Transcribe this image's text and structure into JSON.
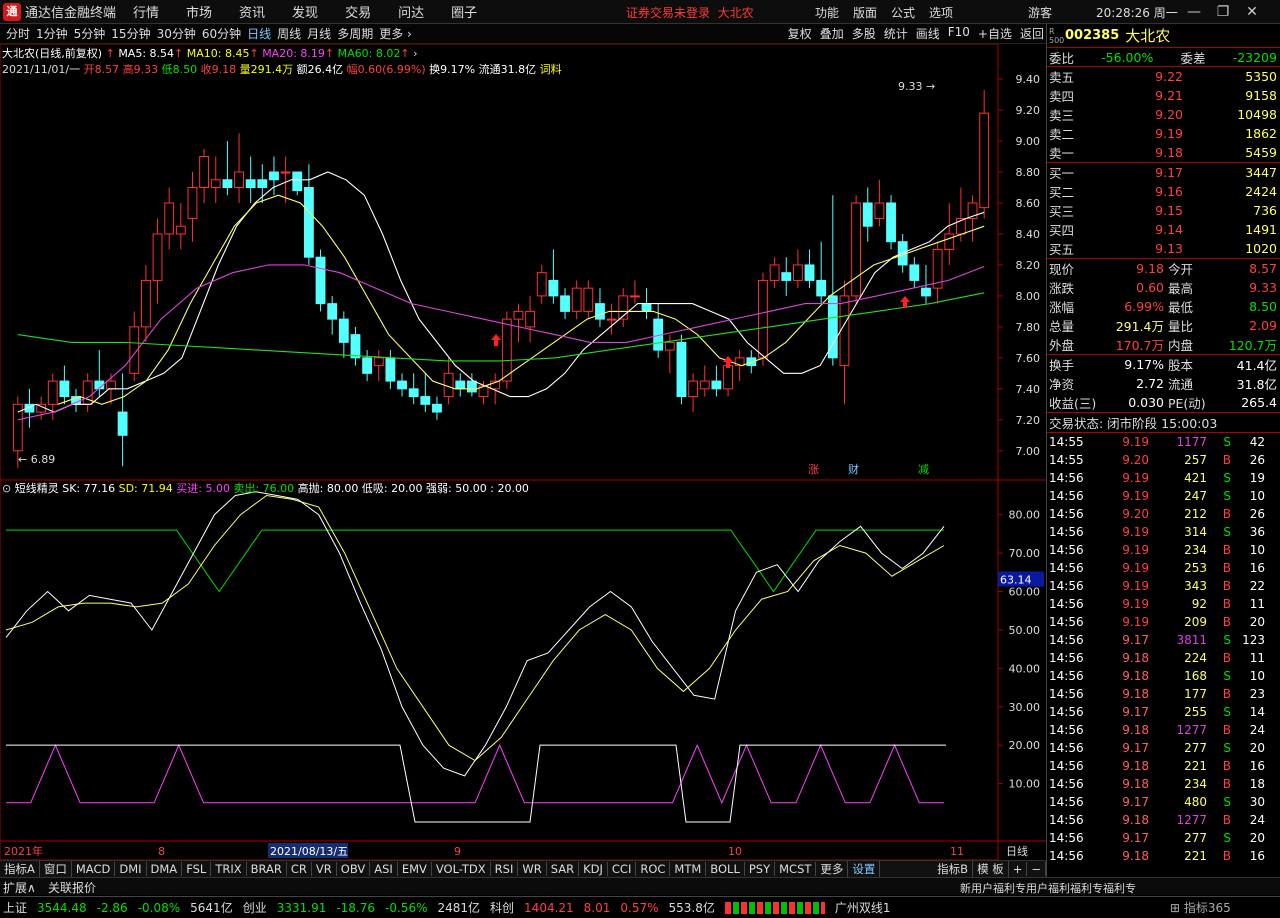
{
  "titlebar": {
    "logo": "通",
    "app": "通达信金融终端",
    "menus": [
      "行情",
      "市场",
      "资讯",
      "发现",
      "交易",
      "问达",
      "圈子"
    ],
    "warn": "证券交易未登录",
    "warn_stock": "大北农",
    "right_items": [
      "功能",
      "版面",
      "公式",
      "选项"
    ],
    "guest": "游客",
    "time": "20:28:26 周一"
  },
  "toolbar": {
    "periods": [
      "分时",
      "1分钟",
      "5分钟",
      "15分钟",
      "30分钟",
      "60分钟",
      "日线",
      "周线",
      "月线",
      "多周期",
      "更多 ›"
    ],
    "active": "日线",
    "right": [
      "复权",
      "叠加",
      "多股",
      "统计",
      "画线",
      "F10",
      "+自选",
      "返回"
    ]
  },
  "info": {
    "name": "大北农(日线,前复权)",
    "ma5": "MA5: 8.54",
    "ma10": "MA10: 8.45",
    "ma20": "MA20: 8.19",
    "ma60": "MA60: 8.02",
    "date": "2021/11/01/一",
    "open": "开8.57",
    "high": "高9.33",
    "low": "低8.50",
    "close": "收9.18",
    "vol": "量291.4万",
    "amt": "额26.4亿",
    "chg": "幅0.60(6.99%)",
    "turn": "换9.17%",
    "float": "流通31.8亿",
    "extra": "词料"
  },
  "chart_data": [
    {
      "type": "candlestick",
      "title": "大北农(日线,前复权)",
      "ylim": [
        6.89,
        9.33
      ],
      "yticks": [
        7.0,
        7.2,
        7.4,
        7.6,
        7.8,
        8.0,
        8.2,
        8.4,
        8.6,
        8.8,
        9.0,
        9.2,
        9.4
      ],
      "xlabels": [
        "2021年",
        "8",
        "2021/08/13/五",
        "9",
        "10",
        "11"
      ],
      "annotations": [
        "9.33",
        "6.89",
        "涨",
        "财",
        "减"
      ],
      "ohlc": [
        [
          7.0,
          7.35,
          6.89,
          7.3
        ],
        [
          7.3,
          7.4,
          7.15,
          7.25
        ],
        [
          7.25,
          7.35,
          7.2,
          7.3
        ],
        [
          7.3,
          7.5,
          7.2,
          7.45
        ],
        [
          7.45,
          7.55,
          7.3,
          7.35
        ],
        [
          7.35,
          7.4,
          7.25,
          7.3
        ],
        [
          7.3,
          7.5,
          7.25,
          7.45
        ],
        [
          7.45,
          7.65,
          7.35,
          7.4
        ],
        [
          7.4,
          7.5,
          7.3,
          7.45
        ],
        [
          7.25,
          7.5,
          6.9,
          7.1
        ],
        [
          7.5,
          7.9,
          7.45,
          7.8
        ],
        [
          7.8,
          8.2,
          7.7,
          8.1
        ],
        [
          8.1,
          8.5,
          7.95,
          8.4
        ],
        [
          8.4,
          8.7,
          8.3,
          8.6
        ],
        [
          8.4,
          8.6,
          8.3,
          8.45
        ],
        [
          8.5,
          8.8,
          8.35,
          8.7
        ],
        [
          8.7,
          8.95,
          8.6,
          8.9
        ],
        [
          8.7,
          8.9,
          8.6,
          8.75
        ],
        [
          8.75,
          9.0,
          8.65,
          8.7
        ],
        [
          8.7,
          9.05,
          8.6,
          8.8
        ],
        [
          8.75,
          8.9,
          8.6,
          8.7
        ],
        [
          8.75,
          8.85,
          8.6,
          8.7
        ],
        [
          8.8,
          8.9,
          8.65,
          8.75
        ],
        [
          8.8,
          8.9,
          8.6,
          8.8
        ],
        [
          8.8,
          8.8,
          8.65,
          8.68
        ],
        [
          8.7,
          8.85,
          8.2,
          8.25
        ],
        [
          8.25,
          8.3,
          7.9,
          7.95
        ],
        [
          7.95,
          8.0,
          7.75,
          7.85
        ],
        [
          7.85,
          7.9,
          7.6,
          7.7
        ],
        [
          7.75,
          7.8,
          7.55,
          7.6
        ],
        [
          7.6,
          7.65,
          7.45,
          7.5
        ],
        [
          7.55,
          7.65,
          7.45,
          7.6
        ],
        [
          7.6,
          7.65,
          7.4,
          7.45
        ],
        [
          7.45,
          7.5,
          7.35,
          7.4
        ],
        [
          7.4,
          7.5,
          7.3,
          7.35
        ],
        [
          7.35,
          7.5,
          7.25,
          7.3
        ],
        [
          7.3,
          7.35,
          7.2,
          7.25
        ],
        [
          7.35,
          7.6,
          7.3,
          7.5
        ],
        [
          7.45,
          7.5,
          7.35,
          7.4
        ],
        [
          7.45,
          7.5,
          7.35,
          7.38
        ],
        [
          7.35,
          7.45,
          7.3,
          7.42
        ],
        [
          7.4,
          7.5,
          7.3,
          7.45
        ],
        [
          7.45,
          7.9,
          7.4,
          7.85
        ],
        [
          7.85,
          7.95,
          7.7,
          7.9
        ],
        [
          7.8,
          8.0,
          7.7,
          7.9
        ],
        [
          8.0,
          8.2,
          7.95,
          8.15
        ],
        [
          8.1,
          8.3,
          7.95,
          8.0
        ],
        [
          8.0,
          8.05,
          7.85,
          7.9
        ],
        [
          7.9,
          8.1,
          7.85,
          8.05
        ],
        [
          7.9,
          8.1,
          7.85,
          8.05
        ],
        [
          7.95,
          8.05,
          7.8,
          7.85
        ],
        [
          7.85,
          7.95,
          7.75,
          7.85
        ],
        [
          7.85,
          8.05,
          7.8,
          8.0
        ],
        [
          8.0,
          8.1,
          7.95,
          8.0
        ],
        [
          7.95,
          8.05,
          7.85,
          7.9
        ],
        [
          7.85,
          7.95,
          7.6,
          7.65
        ],
        [
          7.65,
          7.75,
          7.5,
          7.7
        ],
        [
          7.7,
          7.75,
          7.3,
          7.35
        ],
        [
          7.35,
          7.5,
          7.25,
          7.45
        ],
        [
          7.4,
          7.55,
          7.35,
          7.45
        ],
        [
          7.45,
          7.55,
          7.35,
          7.4
        ],
        [
          7.4,
          7.6,
          7.35,
          7.55
        ],
        [
          7.55,
          7.65,
          7.45,
          7.6
        ],
        [
          7.6,
          7.65,
          7.5,
          7.55
        ],
        [
          7.6,
          8.15,
          7.55,
          8.1
        ],
        [
          8.1,
          8.25,
          8.05,
          8.2
        ],
        [
          8.15,
          8.25,
          8.0,
          8.1
        ],
        [
          8.1,
          8.3,
          8.05,
          8.2
        ],
        [
          8.2,
          8.3,
          8.05,
          8.1
        ],
        [
          8.1,
          8.35,
          7.95,
          8.0
        ],
        [
          8.0,
          8.65,
          7.55,
          7.6
        ],
        [
          7.55,
          8.1,
          7.3,
          8.0
        ],
        [
          8.0,
          8.65,
          7.95,
          8.6
        ],
        [
          8.6,
          8.7,
          8.35,
          8.45
        ],
        [
          8.5,
          8.75,
          8.45,
          8.6
        ],
        [
          8.6,
          8.65,
          8.3,
          8.35
        ],
        [
          8.35,
          8.4,
          8.15,
          8.2
        ],
        [
          8.2,
          8.25,
          8.05,
          8.1
        ],
        [
          8.05,
          8.2,
          7.95,
          8.0
        ],
        [
          8.05,
          8.35,
          7.95,
          8.3
        ],
        [
          8.3,
          8.6,
          8.2,
          8.4
        ],
        [
          8.4,
          8.7,
          8.35,
          8.5
        ],
        [
          8.5,
          8.65,
          8.35,
          8.6
        ],
        [
          8.57,
          9.33,
          8.5,
          9.18
        ]
      ],
      "series": [
        {
          "name": "MA5",
          "color": "#ffffff",
          "values": [
            7.25,
            7.3,
            7.25,
            7.3,
            7.3,
            7.4,
            7.4,
            7.45,
            7.5,
            7.6,
            7.9,
            8.2,
            8.45,
            8.6,
            8.7,
            8.75,
            8.75,
            8.8,
            8.75,
            8.65,
            8.4,
            8.1,
            7.85,
            7.7,
            7.55,
            7.45,
            7.4,
            7.35,
            7.35,
            7.4,
            7.5,
            7.65,
            7.75,
            7.85,
            7.95,
            7.95,
            7.95,
            7.95,
            7.9,
            7.85,
            7.7,
            7.6,
            7.5,
            7.5,
            7.55,
            7.75,
            7.95,
            8.15,
            8.25,
            8.3,
            8.35,
            8.45,
            8.5,
            8.54
          ]
        },
        {
          "name": "MA10",
          "color": "#ffff66",
          "values": [
            7.3,
            7.35,
            7.3,
            7.35,
            7.45,
            7.65,
            7.95,
            8.2,
            8.45,
            8.6,
            8.65,
            8.6,
            8.45,
            8.25,
            8.0,
            7.75,
            7.6,
            7.45,
            7.4,
            7.4,
            7.45,
            7.55,
            7.65,
            7.75,
            7.85,
            7.9,
            7.9,
            7.9,
            7.85,
            7.75,
            7.6,
            7.55,
            7.6,
            7.7,
            7.85,
            8.0,
            8.1,
            8.2,
            8.25,
            8.3,
            8.35,
            8.4,
            8.45
          ]
        },
        {
          "name": "MA20",
          "color": "#dd44dd",
          "values": [
            7.2,
            7.25,
            7.35,
            7.55,
            7.85,
            8.05,
            8.15,
            8.2,
            8.2,
            8.15,
            8.05,
            7.95,
            7.9,
            7.85,
            7.8,
            7.75,
            7.7,
            7.7,
            7.75,
            7.8,
            7.85,
            7.9,
            7.95,
            7.95,
            8.0,
            8.05,
            8.1,
            8.19
          ]
        },
        {
          "name": "MA60",
          "color": "#22dd22",
          "values": [
            7.75,
            7.7,
            7.7,
            7.68,
            7.66,
            7.64,
            7.62,
            7.6,
            7.58,
            7.58,
            7.6,
            7.65,
            7.7,
            7.75,
            7.8,
            7.85,
            7.9,
            7.95,
            8.02
          ]
        }
      ]
    },
    {
      "type": "line",
      "title": "短线精灵",
      "ylim": [
        0,
        88
      ],
      "yticks": [
        10,
        20,
        30,
        40,
        50,
        60,
        70,
        80
      ],
      "current": "63.14",
      "series": [
        {
          "name": "SK",
          "color": "#ffffff",
          "values": [
            48,
            55,
            60,
            55,
            59,
            58,
            57,
            50,
            60,
            70,
            80,
            85,
            86,
            85,
            84,
            80,
            70,
            57,
            45,
            30,
            20,
            14,
            12,
            20,
            30,
            42,
            44,
            50,
            56,
            60,
            56,
            47,
            40,
            33,
            32,
            55,
            65,
            67,
            60,
            68,
            73,
            77,
            70,
            66,
            70,
            77
          ]
        },
        {
          "name": "SD",
          "color": "#ffff66",
          "values": [
            50,
            52,
            56,
            57,
            57,
            56,
            57,
            62,
            72,
            80,
            85,
            84,
            82,
            70,
            55,
            40,
            30,
            20,
            16,
            22,
            32,
            42,
            50,
            54,
            50,
            40,
            34,
            40,
            50,
            58,
            60,
            68,
            72,
            70,
            64,
            68,
            72
          ]
        },
        {
          "name": "买进",
          "color": "#ff40ff",
          "values": [
            5,
            5,
            20,
            5,
            5,
            5,
            5,
            20,
            5,
            5,
            5,
            5,
            5,
            5,
            5,
            5,
            5,
            5,
            5,
            5,
            20,
            5,
            5,
            5,
            5,
            5,
            5,
            5,
            20,
            5,
            20,
            5,
            5,
            20,
            5,
            5,
            20,
            5,
            5
          ]
        },
        {
          "name": "卖出",
          "color": "#00e000",
          "values": [
            76,
            76,
            76,
            76,
            76,
            60,
            76,
            76,
            76,
            76,
            76,
            76,
            76,
            76,
            76,
            76,
            76,
            76,
            60,
            76,
            76,
            76,
            76
          ]
        }
      ]
    }
  ],
  "indicator": {
    "name": "短线精灵",
    "sk": "SK: 77.16",
    "sd": "SD: 71.94",
    "buy": "买进: 5.00",
    "sell": "卖出: 76.00",
    "params": "高抛: 80.00 低吸: 20.00 强弱: 50.00 : 20.00"
  },
  "bottomtabs": [
    "指标A",
    "窗口",
    "MACD",
    "DMI",
    "DMA",
    "FSL",
    "TRIX",
    "BRAR",
    "CR",
    "VR",
    "OBV",
    "ASI",
    "EMV",
    "VOL-TDX",
    "RSI",
    "WR",
    "SAR",
    "KDJ",
    "CCI",
    "ROC",
    "MTM",
    "BOLL",
    "PSY",
    "MCST",
    "更多",
    "设置",
    "指标B",
    "模 板",
    "+",
    "−"
  ],
  "daily_label": "日线",
  "ext": {
    "a": "扩展∧",
    "b": "关联报价",
    "marquee": "新用户福利专用户福利福利专福利专"
  },
  "status": {
    "sh": "上证",
    "sh_v": "3544.48",
    "sh_c": "-2.86",
    "sh_p": "-0.08%",
    "sh_a": "5641亿",
    "cy": "创业",
    "cy_v": "3331.91",
    "cy_c": "-18.76",
    "cy_p": "-0.56%",
    "cy_a": "2481亿",
    "kc": "科创",
    "kc_v": "1404.21",
    "kc_c": "8.01",
    "kc_p": "0.57%",
    "kc_a": "553.8亿",
    "line": "广州双线1",
    "brand": "指标365"
  },
  "quote": {
    "badge": "R 500",
    "code": "002385",
    "name": "大北农",
    "wb_l": "委比",
    "wb": "-56.00%",
    "wc_l": "委差",
    "wc": "-23209",
    "asks": [
      [
        "卖五",
        "9.22",
        "5350"
      ],
      [
        "卖四",
        "9.21",
        "9158"
      ],
      [
        "卖三",
        "9.20",
        "10498"
      ],
      [
        "卖二",
        "9.19",
        "1862"
      ],
      [
        "卖一",
        "9.18",
        "5459"
      ]
    ],
    "bids": [
      [
        "买一",
        "9.17",
        "3447"
      ],
      [
        "买二",
        "9.16",
        "2424"
      ],
      [
        "买三",
        "9.15",
        "736"
      ],
      [
        "买四",
        "9.14",
        "1491"
      ],
      [
        "买五",
        "9.13",
        "1020"
      ]
    ],
    "stats": [
      [
        "现价",
        "9.18",
        "今开",
        "8.57"
      ],
      [
        "涨跌",
        "0.60",
        "最高",
        "9.33"
      ],
      [
        "涨幅",
        "6.99%",
        "最低",
        "8.50"
      ],
      [
        "总量",
        "291.4万",
        "量比",
        "2.09"
      ],
      [
        "外盘",
        "170.7万",
        "内盘",
        "120.7万"
      ]
    ],
    "stats2": [
      [
        "换手",
        "9.17%",
        "股本",
        "41.4亿"
      ],
      [
        "净资",
        "2.72",
        "流通",
        "31.8亿"
      ],
      [
        "收益(三)",
        "0.030",
        "PE(动)",
        "265.4"
      ]
    ],
    "state": "交易状态: 闭市阶段 15:00:03",
    "trades": [
      [
        "14:55",
        "9.19",
        "1177",
        "S",
        "42"
      ],
      [
        "14:55",
        "9.20",
        "257",
        "B",
        "26"
      ],
      [
        "14:56",
        "9.19",
        "421",
        "S",
        "19"
      ],
      [
        "14:56",
        "9.19",
        "247",
        "S",
        "10"
      ],
      [
        "14:56",
        "9.20",
        "212",
        "B",
        "26"
      ],
      [
        "14:56",
        "9.19",
        "314",
        "S",
        "36"
      ],
      [
        "14:56",
        "9.19",
        "234",
        "B",
        "10"
      ],
      [
        "14:56",
        "9.19",
        "253",
        "B",
        "16"
      ],
      [
        "14:56",
        "9.19",
        "343",
        "B",
        "22"
      ],
      [
        "14:56",
        "9.19",
        "92",
        "B",
        "11"
      ],
      [
        "14:56",
        "9.19",
        "209",
        "B",
        "20"
      ],
      [
        "14:56",
        "9.17",
        "3811",
        "S",
        "123"
      ],
      [
        "14:56",
        "9.18",
        "224",
        "B",
        "11"
      ],
      [
        "14:56",
        "9.18",
        "168",
        "S",
        "10"
      ],
      [
        "14:56",
        "9.18",
        "177",
        "B",
        "23"
      ],
      [
        "14:56",
        "9.17",
        "255",
        "S",
        "14"
      ],
      [
        "14:56",
        "9.18",
        "1277",
        "B",
        "24"
      ],
      [
        "14:56",
        "9.17",
        "277",
        "S",
        "20"
      ],
      [
        "14:56",
        "9.18",
        "221",
        "B",
        "16"
      ],
      [
        "14:56",
        "9.18",
        "234",
        "B",
        "18"
      ],
      [
        "14:56",
        "9.17",
        "480",
        "S",
        "30"
      ],
      [
        "14:56",
        "9.18",
        "1277",
        "B",
        "24"
      ],
      [
        "14:56",
        "9.17",
        "277",
        "S",
        "20"
      ],
      [
        "14:56",
        "9.18",
        "221",
        "B",
        "16"
      ]
    ]
  },
  "colors": {
    "up": "#ff3030",
    "down": "#54ffff",
    "ma5": "#ffffff",
    "ma10": "#ffff66",
    "ma20": "#dd44dd",
    "ma60": "#22dd22"
  }
}
